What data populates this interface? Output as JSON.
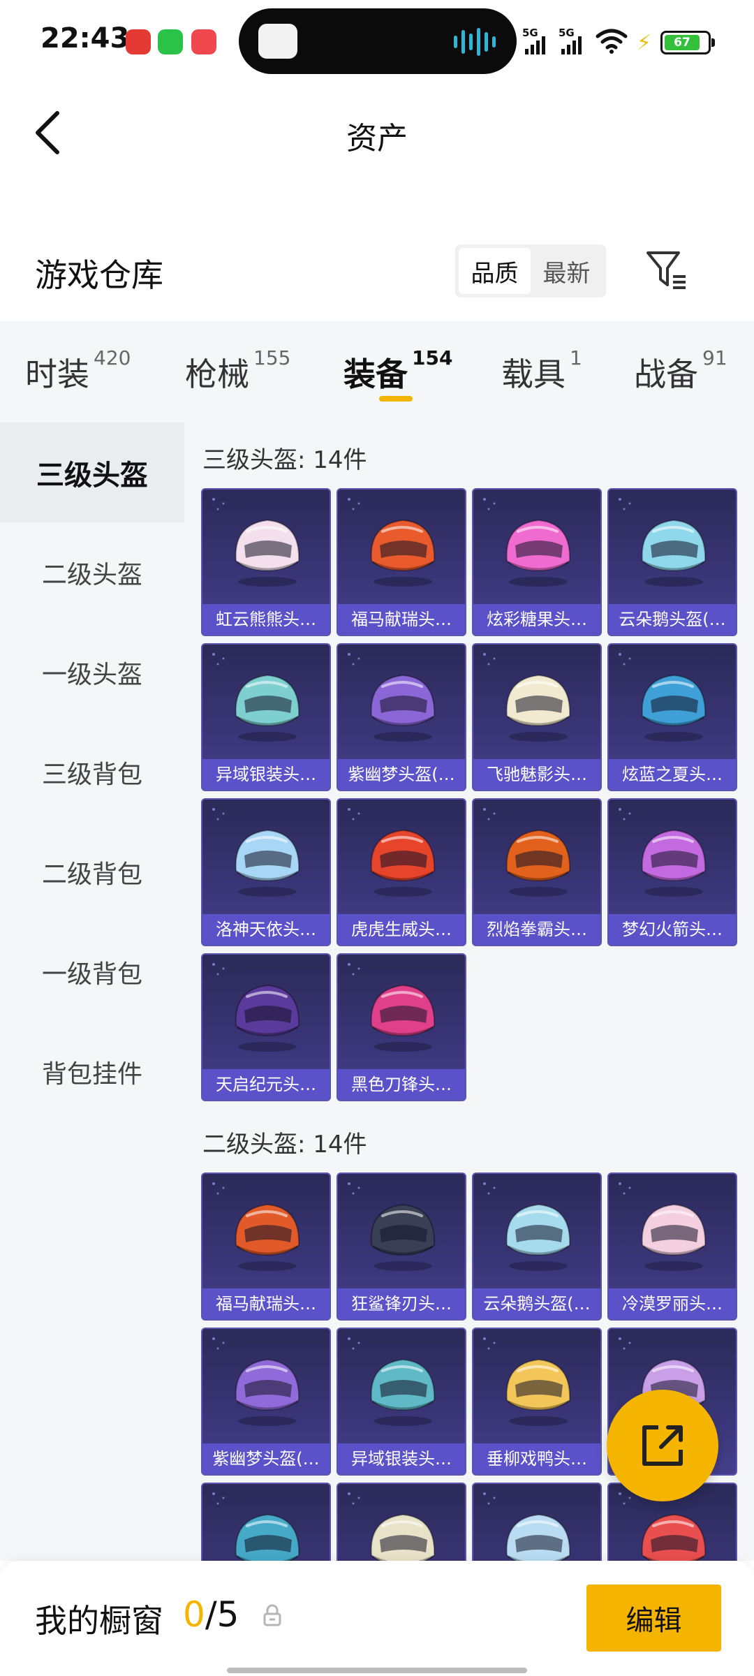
{
  "status_bar": {
    "time": "22:43",
    "network_left": "5G",
    "network_right": "5G",
    "battery": "67"
  },
  "header": {
    "title": "资产",
    "back_icon": "chevron-left-icon"
  },
  "warehouse": {
    "title": "游戏仓库",
    "sort_options": [
      "品质",
      "最新"
    ],
    "sort_selected": "品质",
    "filter_icon": "filter-icon"
  },
  "tabs": [
    {
      "label": "时装",
      "count": "420"
    },
    {
      "label": "枪械",
      "count": "155"
    },
    {
      "label": "装备",
      "count": "154"
    },
    {
      "label": "载具",
      "count": "1"
    },
    {
      "label": "战备",
      "count": "91"
    }
  ],
  "active_tab": "装备",
  "subnav": [
    {
      "label": "三级头盔"
    },
    {
      "label": "二级头盔"
    },
    {
      "label": "一级头盔"
    },
    {
      "label": "三级背包"
    },
    {
      "label": "二级背包"
    },
    {
      "label": "一级背包"
    },
    {
      "label": "背包挂件"
    }
  ],
  "sections": [
    {
      "title": "三级头盔: 14件",
      "items": [
        {
          "label": "虹云熊熊头…",
          "accent": "#f4e0ec"
        },
        {
          "label": "福马献瑞头…",
          "accent": "#e95a2c"
        },
        {
          "label": "炫彩糖果头…",
          "accent": "#f06bd0"
        },
        {
          "label": "云朵鹅头盔(…",
          "accent": "#8fd7ea"
        },
        {
          "label": "异域银装头…",
          "accent": "#7ecfd0"
        },
        {
          "label": "紫幽梦头盔(…",
          "accent": "#8a66d6"
        },
        {
          "label": "飞驰魅影头…",
          "accent": "#f1ead0"
        },
        {
          "label": "炫蓝之夏头…",
          "accent": "#3fa0d8"
        },
        {
          "label": "洛神天依头…",
          "accent": "#a8d6f5"
        },
        {
          "label": "虎虎生威头…",
          "accent": "#e7442c"
        },
        {
          "label": "烈焰拳霸头…",
          "accent": "#e2611c"
        },
        {
          "label": "梦幻火箭头…",
          "accent": "#c46ae0"
        },
        {
          "label": "天启纪元头…",
          "accent": "#5a3a9a"
        },
        {
          "label": "黑色刀锋头…",
          "accent": "#e0408a"
        }
      ]
    },
    {
      "title": "二级头盔: 14件",
      "items": [
        {
          "label": "福马献瑞头…",
          "accent": "#e25a2a"
        },
        {
          "label": "狂鲨锋刃头…",
          "accent": "#3a3f55"
        },
        {
          "label": "云朵鹅头盔(…",
          "accent": "#a6dbee"
        },
        {
          "label": "冷漠罗丽头…",
          "accent": "#f4cfe0"
        },
        {
          "label": "紫幽梦头盔(…",
          "accent": "#8f6ad8"
        },
        {
          "label": "异域银装头…",
          "accent": "#5fb9c6"
        },
        {
          "label": "垂柳戏鸭头…",
          "accent": "#f3c65a"
        },
        {
          "label": "",
          "accent": "#c9a0e8"
        },
        {
          "label": "",
          "accent": "#46a9c7"
        },
        {
          "label": "",
          "accent": "#e8e2c8"
        },
        {
          "label": "",
          "accent": "#b9dcf2"
        },
        {
          "label": "",
          "accent": "#e94f4f"
        }
      ]
    }
  ],
  "bottom_bar": {
    "showcase_label": "我的橱窗",
    "showcase_used": "0",
    "showcase_total": "/5",
    "edit_label": "编辑"
  }
}
